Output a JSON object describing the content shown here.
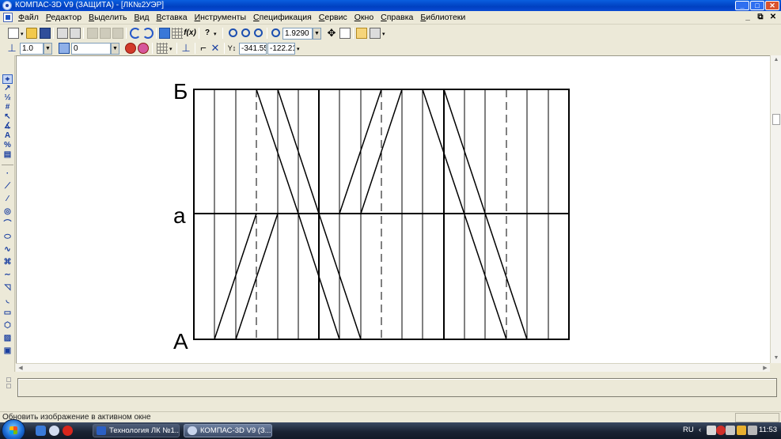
{
  "window": {
    "title": "КОМПАС-3D V9 (ЗАЩИТА) - [ЛК№2УЭР]",
    "minimize": "_",
    "maximize": "□",
    "close": "✕"
  },
  "menu": {
    "items": [
      "Файл",
      "Редактор",
      "Выделить",
      "Вид",
      "Вставка",
      "Инструменты",
      "Спецификация",
      "Сервис",
      "Окно",
      "Справка",
      "Библиотеки"
    ],
    "mdi_minimize": "_",
    "mdi_restore": "⧉",
    "mdi_close": "✕"
  },
  "toolbar1": {
    "fx_label": "f(x)",
    "help_label": "?",
    "zoom_value": "1.9290"
  },
  "toolbar2": {
    "step_value": "1.0",
    "layer_value": "0",
    "coord_x": "-341.55",
    "coord_y": "-122.21"
  },
  "drawing": {
    "label_top": "Б",
    "label_mid": "а",
    "label_bottom": "А"
  },
  "status": {
    "text": "Обновить изображение в активном окне"
  },
  "taskbar": {
    "tasks": [
      {
        "label": "Технология ЛК №1...",
        "active": false
      },
      {
        "label": "КОМПАС-3D V9 (З...",
        "active": true
      }
    ],
    "language": "RU",
    "clock": "11:53"
  },
  "colors": {
    "titlebar": "#0a50d8",
    "canvas": "#ffffff",
    "chrome": "#ece9d8",
    "taskbar": "#1a2333"
  }
}
